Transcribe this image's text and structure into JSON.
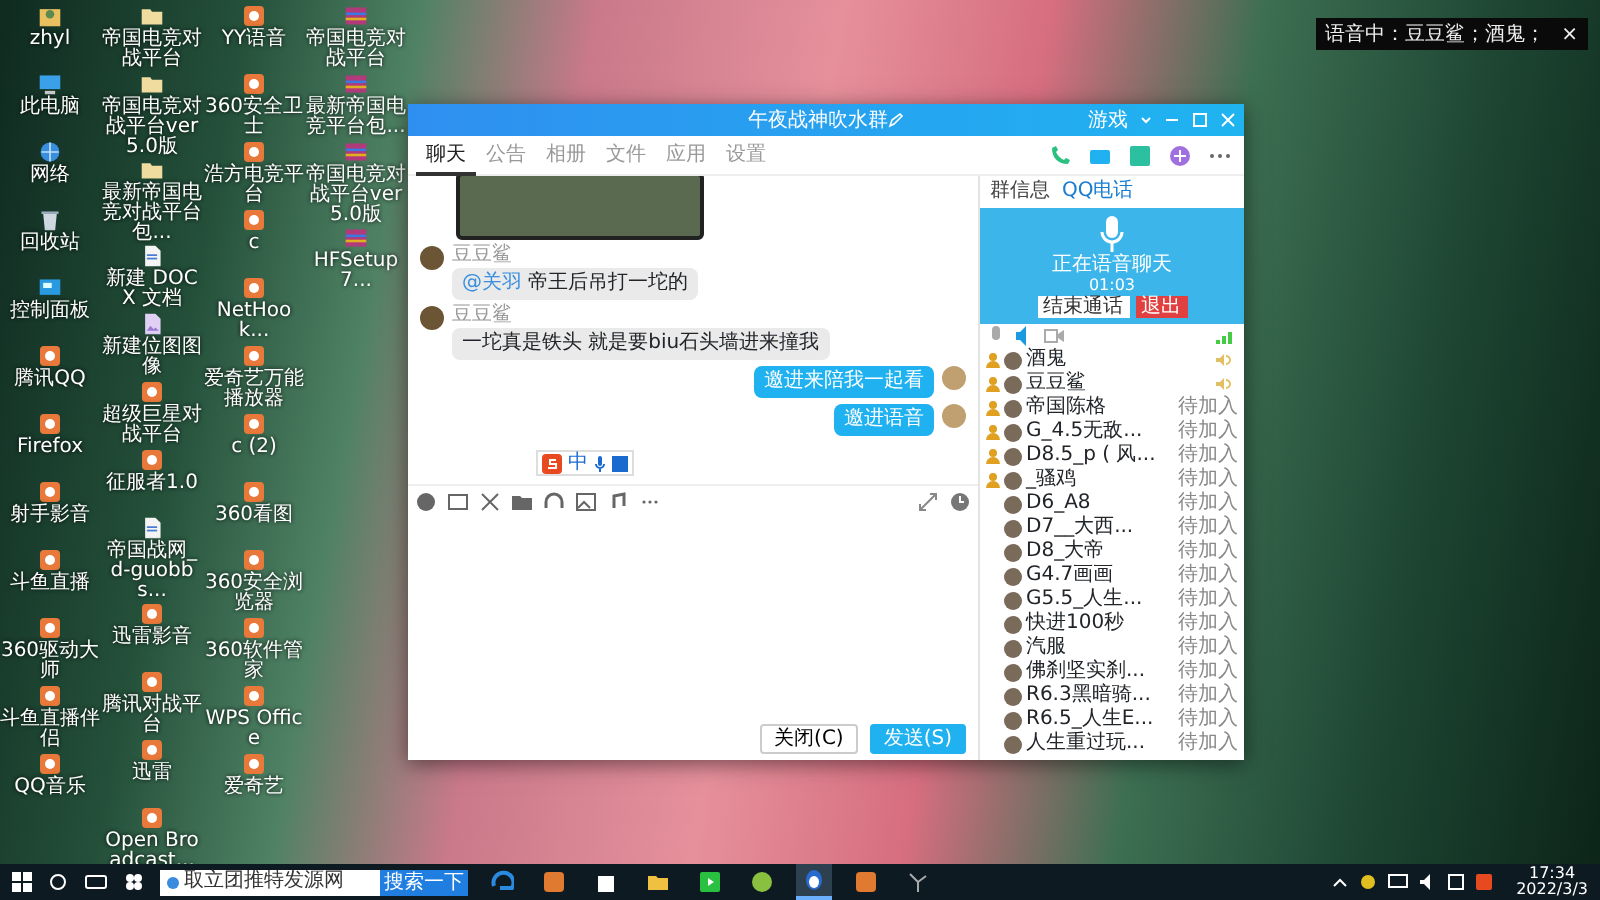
{
  "notification": {
    "text": "语音中：豆豆鲨；酒鬼；",
    "close": "×"
  },
  "desktop_columns": [
    [
      {
        "label": "zhyl",
        "kind": "user"
      },
      {
        "label": "此电脑",
        "kind": "computer"
      },
      {
        "label": "网络",
        "kind": "network"
      },
      {
        "label": "回收站",
        "kind": "recycle"
      },
      {
        "label": "控制面板",
        "kind": "panel"
      },
      {
        "label": "腾讯QQ",
        "kind": "app"
      },
      {
        "label": "Firefox",
        "kind": "app"
      },
      {
        "label": "射手影音",
        "kind": "app"
      },
      {
        "label": "斗鱼直播",
        "kind": "app"
      },
      {
        "label": "360驱动大师",
        "kind": "app"
      },
      {
        "label": "斗鱼直播伴侣",
        "kind": "app"
      },
      {
        "label": "QQ音乐",
        "kind": "app"
      }
    ],
    [
      {
        "label": "帝国电竞对战平台",
        "kind": "folder"
      },
      {
        "label": "帝国电竞对战平台ver5.0版",
        "kind": "folder"
      },
      {
        "label": "最新帝国电竞对战平台包...",
        "kind": "folder"
      },
      {
        "label": "新建 DOCX 文档",
        "kind": "document"
      },
      {
        "label": "新建位图图像",
        "kind": "image"
      },
      {
        "label": "超级巨星对战平台",
        "kind": "app"
      },
      {
        "label": "征服者1.0",
        "kind": "app"
      },
      {
        "label": "帝国战网_d-guobbs...",
        "kind": "document"
      },
      {
        "label": "迅雷影音",
        "kind": "app"
      },
      {
        "label": "腾讯对战平台",
        "kind": "app"
      },
      {
        "label": "迅雷",
        "kind": "app"
      },
      {
        "label": "Open Broadcast...",
        "kind": "app"
      }
    ],
    [
      {
        "label": "YY语音",
        "kind": "app"
      },
      {
        "label": "360安全卫士",
        "kind": "app"
      },
      {
        "label": "浩方电竞平台",
        "kind": "app"
      },
      {
        "label": "c",
        "kind": "app"
      },
      {
        "label": "NetHook...",
        "kind": "app"
      },
      {
        "label": "爱奇艺万能播放器",
        "kind": "app"
      },
      {
        "label": "c (2)",
        "kind": "app"
      },
      {
        "label": "360看图",
        "kind": "app"
      },
      {
        "label": "360安全浏览器",
        "kind": "app"
      },
      {
        "label": "360软件管家",
        "kind": "app"
      },
      {
        "label": "WPS Office",
        "kind": "app"
      },
      {
        "label": "爱奇艺",
        "kind": "app"
      }
    ],
    [
      {
        "label": "帝国电竞对战平台",
        "kind": "archive"
      },
      {
        "label": "最新帝国电竞平台包...",
        "kind": "archive"
      },
      {
        "label": "帝国电竞对战平台ver5.0版",
        "kind": "archive"
      },
      {
        "label": "HFSetup7...",
        "kind": "archive"
      }
    ]
  ],
  "chat_window": {
    "title": "午夜战神吹水群",
    "controls": "游戏",
    "tabs": [
      {
        "label": "聊天",
        "selected": true
      },
      {
        "label": "公告",
        "selected": false
      },
      {
        "label": "相册",
        "selected": false
      },
      {
        "label": "文件",
        "selected": false
      },
      {
        "label": "应用",
        "selected": false
      },
      {
        "label": "设置",
        "selected": false
      }
    ],
    "messages": [
      {
        "kind": "image"
      },
      {
        "kind": "incoming",
        "sender": "豆豆鲨",
        "mention": "@关羽",
        "text": "帝王后吊打一坨的"
      },
      {
        "kind": "incoming",
        "sender": "豆豆鲨",
        "text": "一坨真是铁头 就是要biu石头墙进来撞我"
      },
      {
        "kind": "outgoing",
        "text": "邀进来陪我一起看"
      },
      {
        "kind": "outgoing",
        "text": "邀进语音"
      }
    ],
    "ime_label": "中",
    "close_button": "关闭(C)",
    "send_button": "发送(S)",
    "side_tabs": [
      {
        "label": "群信息",
        "selected": false
      },
      {
        "label": "QQ电话",
        "selected": true
      }
    ],
    "call": {
      "status": "正在语音聊天",
      "timer": "01:03",
      "end_button": "结束通话",
      "quit_button": "退出"
    },
    "members": [
      {
        "name": "酒鬼",
        "admin": true,
        "speaking": true
      },
      {
        "name": "豆豆鲨",
        "admin": true,
        "speaking": true
      },
      {
        "name": "帝国陈格",
        "admin": true,
        "speaking": false,
        "status": "待加入"
      },
      {
        "name": "G_4.5无敌...",
        "admin": true,
        "speaking": false,
        "status": "待加入"
      },
      {
        "name": "D8.5_p ( 风...",
        "admin": true,
        "speaking": false,
        "status": "待加入"
      },
      {
        "name": "_骚鸡",
        "admin": true,
        "speaking": false,
        "status": "待加入"
      },
      {
        "name": "D6_A8",
        "admin": false,
        "speaking": false,
        "status": "待加入"
      },
      {
        "name": "D7__大西...",
        "admin": false,
        "speaking": false,
        "status": "待加入"
      },
      {
        "name": "D8_大帝",
        "admin": false,
        "speaking": false,
        "status": "待加入"
      },
      {
        "name": "G4.7画画",
        "admin": false,
        "speaking": false,
        "status": "待加入"
      },
      {
        "name": "G5.5_人生...",
        "admin": false,
        "speaking": false,
        "status": "待加入"
      },
      {
        "name": "快进100秒",
        "admin": false,
        "speaking": false,
        "status": "待加入"
      },
      {
        "name": "汽服",
        "admin": false,
        "speaking": false,
        "status": "待加入"
      },
      {
        "name": "佛刹坚实刹...",
        "admin": false,
        "speaking": false,
        "status": "待加入"
      },
      {
        "name": "R6.3黑暗骑...",
        "admin": false,
        "speaking": false,
        "status": "待加入"
      },
      {
        "name": "R6.5_人生E...",
        "admin": false,
        "speaking": false,
        "status": "待加入"
      },
      {
        "name": "人生重过玩...",
        "admin": false,
        "speaking": false,
        "status": "待加入"
      }
    ]
  },
  "taskbar": {
    "search_text": "取立团推特发源网",
    "search_button": "搜索一下",
    "apps": [
      {
        "kind": "edge",
        "active": false
      },
      {
        "kind": "tile",
        "active": false
      },
      {
        "kind": "store",
        "active": false
      },
      {
        "kind": "folder",
        "active": false
      },
      {
        "kind": "player",
        "active": false
      },
      {
        "kind": "ball",
        "active": false
      },
      {
        "kind": "penguin",
        "active": true
      },
      {
        "kind": "tile",
        "active": false
      },
      {
        "kind": "fan",
        "active": false
      }
    ],
    "time": "17:34",
    "date": "2022/3/3"
  }
}
